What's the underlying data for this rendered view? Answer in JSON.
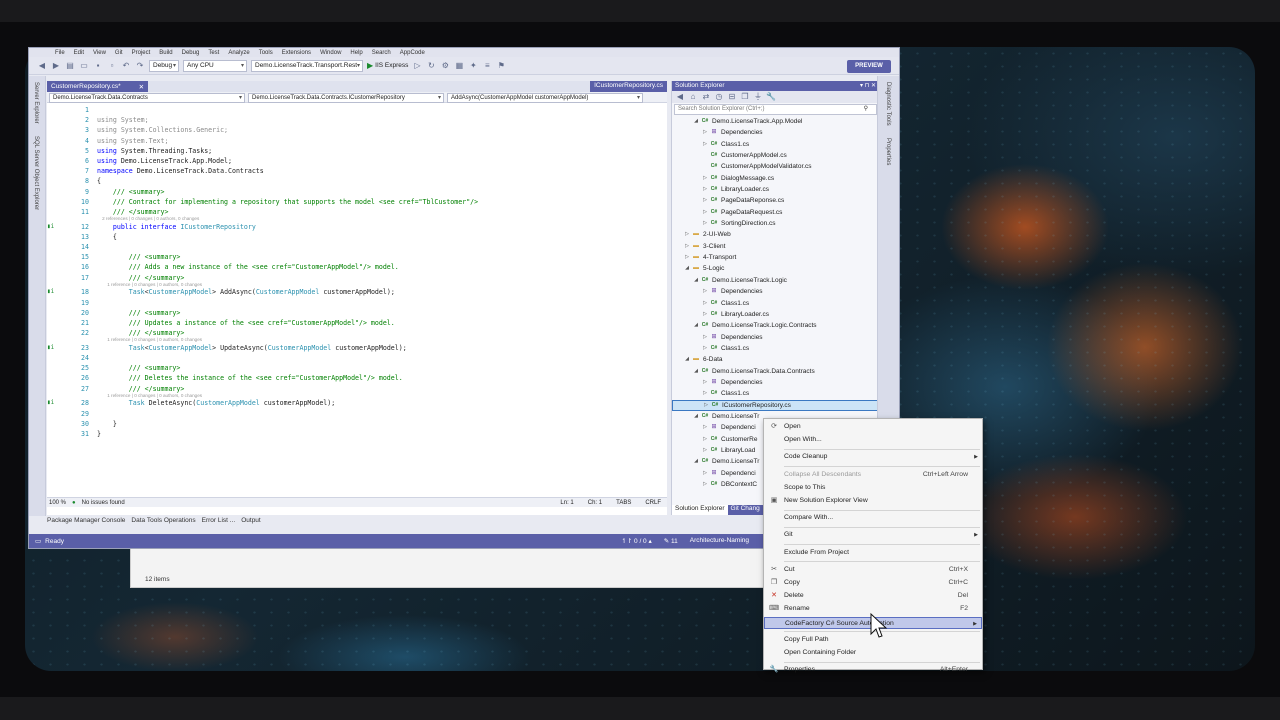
{
  "menu": [
    "File",
    "Edit",
    "View",
    "Git",
    "Project",
    "Build",
    "Debug",
    "Test",
    "Analyze",
    "Tools",
    "Extensions",
    "Window",
    "Help",
    "Search",
    "AppCode"
  ],
  "toolbar": {
    "config": "Debug",
    "platform": "Any CPU",
    "startup_project": "Demo.LicenseTrack.Transport.Rest",
    "run_label": "IIS Express",
    "preview_label": "PREVIEW"
  },
  "side_tabs": {
    "left": [
      "Server Explorer",
      "SQL Server Object Explorer"
    ],
    "right": [
      "Diagnostic Tools",
      "Properties"
    ]
  },
  "editor": {
    "tab_label": "CustomerRepository.cs*",
    "tab_right": "ICustomerRepository.cs",
    "nav_project": "Demo.LicenseTrack.Data.Contracts",
    "nav_type": "Demo.LicenseTrack.Data.Contracts.ICustomerRepository",
    "nav_member": "AddAsync(CustomerAppModel customerAppModel)",
    "lines": [
      {
        "n": "1",
        "t": ""
      },
      {
        "n": "2",
        "parts": [
          [
            "gray",
            "using System;"
          ]
        ]
      },
      {
        "n": "3",
        "parts": [
          [
            "gray",
            "using System.Collections.Generic;"
          ]
        ]
      },
      {
        "n": "4",
        "parts": [
          [
            "gray",
            "using System.Text;"
          ]
        ]
      },
      {
        "n": "5",
        "parts": [
          [
            "kw",
            "using"
          ],
          [
            "",
            "System.Threading.Tasks;"
          ]
        ]
      },
      {
        "n": "6",
        "parts": [
          [
            "kw",
            "using"
          ],
          [
            "",
            "Demo.LicenseTrack.App.Model;"
          ]
        ]
      },
      {
        "n": "7",
        "parts": [
          [
            "kw",
            "namespace"
          ],
          [
            "",
            "Demo.LicenseTrack.Data.Contracts"
          ]
        ]
      },
      {
        "n": "8",
        "parts": [
          [
            "",
            "{"
          ]
        ]
      },
      {
        "n": "9",
        "parts": [
          [
            "cm",
            "    /// <summary>"
          ]
        ]
      },
      {
        "n": "10",
        "parts": [
          [
            "cm",
            "    /// Contract for implementing a repository that supports the model <see cref=\"TblCustomer\"/>"
          ]
        ]
      },
      {
        "n": "11",
        "parts": [
          [
            "cm",
            "    /// </summary>"
          ]
        ]
      },
      {
        "lens": "    2 references | 0 changes | 0 authors, 0 changes"
      },
      {
        "n": "12",
        "mk": "▮i",
        "parts": [
          [
            "kw",
            "    public interface"
          ],
          [
            "ty",
            "ICustomerRepository"
          ]
        ]
      },
      {
        "n": "13",
        "parts": [
          [
            "",
            "    {"
          ]
        ]
      },
      {
        "n": "14",
        "t": ""
      },
      {
        "n": "15",
        "parts": [
          [
            "cm",
            "        /// <summary>"
          ]
        ]
      },
      {
        "n": "16",
        "parts": [
          [
            "cm",
            "        /// Adds a new instance of the <see cref=\"CustomerAppModel\"/> model."
          ]
        ]
      },
      {
        "n": "17",
        "parts": [
          [
            "cm",
            "        /// </summary>"
          ]
        ]
      },
      {
        "lens": "        1 reference | 0 changes | 0 authors, 0 changes"
      },
      {
        "n": "18",
        "mk": "▮i",
        "parts": [
          [
            "ty",
            "        Task"
          ],
          [
            "",
            "<"
          ],
          [
            "ty",
            "CustomerAppModel"
          ],
          [
            "",
            "> AddAsync("
          ],
          [
            "ty",
            "CustomerAppModel"
          ],
          [
            "",
            " customerAppModel);"
          ]
        ]
      },
      {
        "n": "19",
        "t": ""
      },
      {
        "n": "20",
        "parts": [
          [
            "cm",
            "        /// <summary>"
          ]
        ]
      },
      {
        "n": "21",
        "parts": [
          [
            "cm",
            "        /// Updates a instance of the <see cref=\"CustomerAppModel\"/> model."
          ]
        ]
      },
      {
        "n": "22",
        "parts": [
          [
            "cm",
            "        /// </summary>"
          ]
        ]
      },
      {
        "lens": "        1 reference | 0 changes | 0 authors, 0 changes"
      },
      {
        "n": "23",
        "mk": "▮i",
        "parts": [
          [
            "ty",
            "        Task"
          ],
          [
            "",
            "<"
          ],
          [
            "ty",
            "CustomerAppModel"
          ],
          [
            "",
            "> UpdateAsync("
          ],
          [
            "ty",
            "CustomerAppModel"
          ],
          [
            "",
            " customerAppModel);"
          ]
        ]
      },
      {
        "n": "24",
        "t": ""
      },
      {
        "n": "25",
        "parts": [
          [
            "cm",
            "        /// <summary>"
          ]
        ]
      },
      {
        "n": "26",
        "parts": [
          [
            "cm",
            "        /// Deletes the instance of the <see cref=\"CustomerAppModel\"/> model."
          ]
        ]
      },
      {
        "n": "27",
        "parts": [
          [
            "cm",
            "        /// </summary>"
          ]
        ]
      },
      {
        "lens": "        1 reference | 0 changes | 0 authors, 0 changes"
      },
      {
        "n": "28",
        "mk": "▮i",
        "parts": [
          [
            "ty",
            "        Task"
          ],
          [
            "",
            " DeleteAsync("
          ],
          [
            "ty",
            "CustomerAppModel"
          ],
          [
            "",
            " customerAppModel);"
          ]
        ]
      },
      {
        "n": "29",
        "t": ""
      },
      {
        "n": "30",
        "parts": [
          [
            "",
            "    }"
          ]
        ]
      },
      {
        "n": "31",
        "parts": [
          [
            "",
            "}"
          ]
        ]
      }
    ],
    "zoom": "100 %",
    "issues": "No issues found",
    "ln": "Ln: 1",
    "ch": "Ch: 1",
    "tabs": "TABS",
    "eol": "CRLF"
  },
  "bottom_tabs": [
    "Package Manager Console",
    "Data Tools Operations",
    "Error List ...",
    "Output"
  ],
  "status": {
    "ready": "Ready",
    "updown": "↿↾ 0 / 0 ▴",
    "pencil": "✎ 11",
    "branch": "Architecture-Naming"
  },
  "solution_explorer": {
    "title": "Solution Explorer",
    "search_placeholder": "Search Solution Explorer (Ctrl+;)",
    "items": [
      {
        "d": 2,
        "e": "◢",
        "i": "C#",
        "l": "Demo.LicenseTrack.App.Model"
      },
      {
        "d": 3,
        "e": "▷",
        "i": "⊞",
        "l": "Dependencies"
      },
      {
        "d": 3,
        "e": "▷",
        "i": "C#",
        "l": "Class1.cs"
      },
      {
        "d": 3,
        "e": "",
        "i": "C#",
        "l": "CustomerAppModel.cs"
      },
      {
        "d": 3,
        "e": "",
        "i": "C#",
        "l": "CustomerAppModelValidator.cs"
      },
      {
        "d": 3,
        "e": "▷",
        "i": "C#",
        "l": "DialogMessage.cs"
      },
      {
        "d": 3,
        "e": "▷",
        "i": "C#",
        "l": "LibraryLoader.cs"
      },
      {
        "d": 3,
        "e": "▷",
        "i": "C#",
        "l": "PageDataReponse.cs"
      },
      {
        "d": 3,
        "e": "▷",
        "i": "C#",
        "l": "PageDataRequest.cs"
      },
      {
        "d": 3,
        "e": "▷",
        "i": "C#",
        "l": "SortingDirection.cs"
      },
      {
        "d": 1,
        "e": "▷",
        "i": "▬",
        "l": "2-UI-Web"
      },
      {
        "d": 1,
        "e": "▷",
        "i": "▬",
        "l": "3-Client"
      },
      {
        "d": 1,
        "e": "▷",
        "i": "▬",
        "l": "4-Transport"
      },
      {
        "d": 1,
        "e": "◢",
        "i": "▬",
        "l": "5-Logic"
      },
      {
        "d": 2,
        "e": "◢",
        "i": "C#",
        "l": "Demo.LicenseTrack.Logic"
      },
      {
        "d": 3,
        "e": "▷",
        "i": "⊞",
        "l": "Dependencies"
      },
      {
        "d": 3,
        "e": "▷",
        "i": "C#",
        "l": "Class1.cs"
      },
      {
        "d": 3,
        "e": "▷",
        "i": "C#",
        "l": "LibraryLoader.cs"
      },
      {
        "d": 2,
        "e": "◢",
        "i": "C#",
        "l": "Demo.LicenseTrack.Logic.Contracts"
      },
      {
        "d": 3,
        "e": "▷",
        "i": "⊞",
        "l": "Dependencies"
      },
      {
        "d": 3,
        "e": "▷",
        "i": "C#",
        "l": "Class1.cs"
      },
      {
        "d": 1,
        "e": "◢",
        "i": "▬",
        "l": "6-Data"
      },
      {
        "d": 2,
        "e": "◢",
        "i": "C#",
        "l": "Demo.LicenseTrack.Data.Contracts"
      },
      {
        "d": 3,
        "e": "▷",
        "i": "⊞",
        "l": "Dependencies"
      },
      {
        "d": 3,
        "e": "▷",
        "i": "C#",
        "l": "Class1.cs"
      },
      {
        "d": 3,
        "e": "▷",
        "i": "C#",
        "l": "ICustomerRepository.cs",
        "sel": true
      },
      {
        "d": 2,
        "e": "◢",
        "i": "C#",
        "l": "Demo.LicenseTr"
      },
      {
        "d": 3,
        "e": "▷",
        "i": "⊞",
        "l": "Dependenci"
      },
      {
        "d": 3,
        "e": "▷",
        "i": "C#",
        "l": "CustomerRe"
      },
      {
        "d": 3,
        "e": "▷",
        "i": "C#",
        "l": "LibraryLoad"
      },
      {
        "d": 2,
        "e": "◢",
        "i": "C#",
        "l": "Demo.LicenseTr"
      },
      {
        "d": 3,
        "e": "▷",
        "i": "⊞",
        "l": "Dependenci"
      },
      {
        "d": 3,
        "e": "▷",
        "i": "C#",
        "l": "DBContextC"
      }
    ],
    "tab_active": "Solution Explorer",
    "tab_other": "Git Chang"
  },
  "background_window": {
    "count": "12 items"
  },
  "context_menu": {
    "items": [
      {
        "label": "Open",
        "icon": "⟳"
      },
      {
        "label": "Open With..."
      },
      {
        "sep": true
      },
      {
        "label": "Code Cleanup",
        "arrow": true
      },
      {
        "sep": true
      },
      {
        "label": "Collapse All Descendants",
        "sc": "Ctrl+Left Arrow",
        "dis": true
      },
      {
        "label": "Scope to This"
      },
      {
        "label": "New Solution Explorer View",
        "icon": "▣"
      },
      {
        "sep": true
      },
      {
        "label": "Compare With..."
      },
      {
        "sep": true
      },
      {
        "label": "Git",
        "arrow": true
      },
      {
        "sep": true
      },
      {
        "label": "Exclude From Project"
      },
      {
        "sep": true
      },
      {
        "label": "Cut",
        "sc": "Ctrl+X",
        "icon": "✂"
      },
      {
        "label": "Copy",
        "sc": "Ctrl+C",
        "icon": "❐"
      },
      {
        "label": "Delete",
        "sc": "Del",
        "icon": "✕",
        "iconColor": "#c42b1c"
      },
      {
        "label": "Rename",
        "sc": "F2",
        "icon": "⌨"
      },
      {
        "label": "CodeFactory C# Source Automation",
        "arrow": true,
        "hl": true
      },
      {
        "sep": true
      },
      {
        "label": "Copy Full Path"
      },
      {
        "label": "Open Containing Folder"
      },
      {
        "sep": true
      },
      {
        "label": "Properties",
        "sc": "Alt+Enter",
        "icon": "🔧"
      }
    ]
  }
}
